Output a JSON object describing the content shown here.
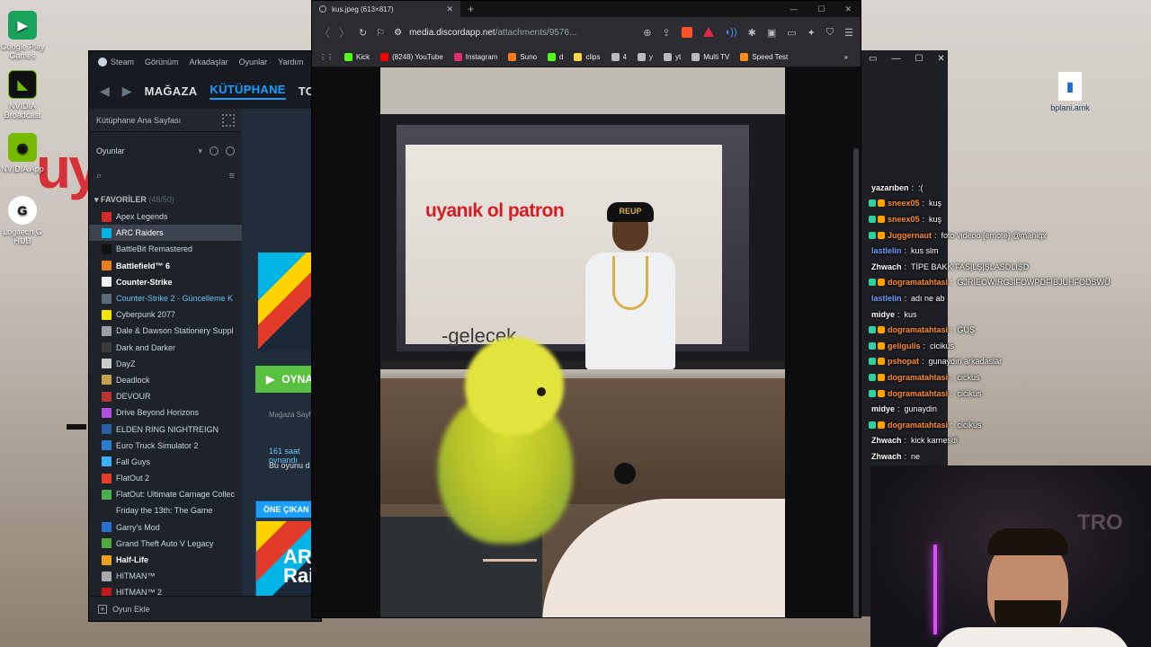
{
  "desktop": {
    "background_text": "uy",
    "icons": [
      {
        "label": "Google Play Games",
        "icon": "google-play-games-icon"
      },
      {
        "label": "NVIDIA Broadcast",
        "icon": "nvidia-broadcast-icon"
      },
      {
        "label": "NVIDIA App",
        "icon": "nvidia-app-icon"
      },
      {
        "label": "Logitech G HUB",
        "icon": "logitech-ghub-icon"
      },
      {
        "label": "bplani.amk",
        "icon": "file-icon"
      }
    ]
  },
  "steam": {
    "menu": [
      "Steam",
      "Görünüm",
      "Arkadaşlar",
      "Oyunlar",
      "Yardım"
    ],
    "nav_tabs": [
      "MAĞAZA",
      "KÜTÜPHANE",
      "TOPLULUK"
    ],
    "home_label": "Kütüphane Ana Sayfası",
    "filter_label": "Oyunlar",
    "favorites": {
      "title": "FAVORİLER",
      "count": "(48/50)"
    },
    "games": [
      {
        "name": "Apex Legends",
        "color": "#d42a2a"
      },
      {
        "name": "ARC Raiders",
        "color": "#00b4e6",
        "selected": true
      },
      {
        "name": "BattleBit Remastered",
        "color": "#111111"
      },
      {
        "name": "Battlefield™ 6",
        "color": "#e67e22",
        "bold": true
      },
      {
        "name": "Counter-Strike",
        "color": "#f0f0f0",
        "bold": true
      },
      {
        "name": "Counter-Strike 2 - Güncelleme K",
        "color": "#5a6b7a",
        "update": true
      },
      {
        "name": "Cyberpunk 2077",
        "color": "#f3e600"
      },
      {
        "name": "Dale & Dawson Stationery Suppl",
        "color": "#9aa0a6"
      },
      {
        "name": "Dark and Darker",
        "color": "#3a3a3a"
      },
      {
        "name": "DayZ",
        "color": "#cccccc"
      },
      {
        "name": "Deadlock",
        "color": "#c8a24a"
      },
      {
        "name": "DEVOUR",
        "color": "#b33"
      },
      {
        "name": "Drive Beyond Horizons",
        "color": "#b24ee0"
      },
      {
        "name": "ELDEN RING NIGHTREIGN",
        "color": "#2b5ea8"
      },
      {
        "name": "Euro Truck Simulator 2",
        "color": "#2a7dd1"
      },
      {
        "name": "Fall Guys",
        "color": "#3ab0ff"
      },
      {
        "name": "FlatOut 2",
        "color": "#e83a2a"
      },
      {
        "name": "FlatOut: Ultimate Carnage Collec",
        "color": "#4bb04b"
      },
      {
        "name": "Friday the 13th: The Game",
        "color": "#222222"
      },
      {
        "name": "Garry's Mod",
        "color": "#2a6fd1"
      },
      {
        "name": "Grand Theft Auto V Legacy",
        "color": "#4fa83f"
      },
      {
        "name": "Half-Life",
        "color": "#f0a020",
        "bold": true
      },
      {
        "name": "HITMAN™",
        "color": "#aaaaaa"
      },
      {
        "name": "HITMAN™ 2",
        "color": "#c21a1a"
      }
    ],
    "play_button": "OYNA",
    "store_page": "Mağaza Sayfası",
    "hours": "161 saat oynandı",
    "update_note": "Bu oyunu d",
    "featured_title": "ÖNE ÇIKAN",
    "featured_art_text": "ARC Raiders",
    "footer": "Oyun Ekle"
  },
  "browser": {
    "tab_title": "kus.jpeg (613×817)",
    "url_domain": "media.discordapp.net",
    "url_path": "/attachments/9576...",
    "bookmarks": [
      {
        "label": "Kick",
        "color": "#53fc18"
      },
      {
        "label": "(8248) YouTube",
        "color": "#ff0000"
      },
      {
        "label": "Instagram",
        "color": "#e1306c"
      },
      {
        "label": "Suno",
        "color": "#ff7a1a"
      },
      {
        "label": "d",
        "color": "#53fc18"
      },
      {
        "label": "clips",
        "color": "#ffd24a"
      },
      {
        "label": "4",
        "color": "#bbbbbb"
      },
      {
        "label": "y",
        "color": "#bbbbbb"
      },
      {
        "label": "yt",
        "color": "#bbbbbb"
      },
      {
        "label": "Multi TV",
        "color": "#bbbbbb"
      },
      {
        "label": "Speed Test",
        "color": "#ff8c1a"
      }
    ],
    "image": {
      "overlay_red": "uyanık ol patron",
      "overlay_gray": "-gelecek",
      "cap_text": "REUP"
    }
  },
  "chat": {
    "lines": [
      {
        "user": "yazarıben",
        "msg": ":(",
        "color": "#ffffff"
      },
      {
        "user": "sneex05",
        "msg": "kuş",
        "color": "#ff8c2b"
      },
      {
        "user": "sneex05",
        "msg": "kuş",
        "color": "#ff8c2b"
      },
      {
        "user": "Juggernaut",
        "msg": "foto videoo [emote] @maniqx",
        "color": "#ff8c2b"
      },
      {
        "user": "lastlelin",
        "msg": "kus slm",
        "color": "#6ca0ff"
      },
      {
        "user": "Zhwach",
        "msg": "TİPE BAKK FAS|LŞ|ŞLASDLIŞD",
        "color": "#ffffff"
      },
      {
        "user": "dogramatahtasi",
        "msg": "GJRIEOWIRGJIFOWPDFIBJUHFODSWÜ",
        "color": "#ff8c2b"
      },
      {
        "user": "lastlelin",
        "msg": "adı ne ab",
        "color": "#6ca0ff"
      },
      {
        "user": "midye",
        "msg": "kus",
        "color": "#ffffff"
      },
      {
        "user": "dogramatahtasi",
        "msg": "GUŞ",
        "color": "#ff8c2b"
      },
      {
        "user": "geligulis",
        "msg": "cicikus",
        "color": "#ff8c2b"
      },
      {
        "user": "pshopat",
        "msg": "gunaydın arkadaslar",
        "color": "#ff8c2b"
      },
      {
        "user": "dogramatahtasi",
        "msg": "cickus",
        "color": "#ff8c2b"
      },
      {
        "user": "dogramatahtasi",
        "msg": "cicikus",
        "color": "#ff8c2b"
      },
      {
        "user": "midye",
        "msg": "gunaydin",
        "color": "#ffffff"
      },
      {
        "user": "dogramatahtasi",
        "msg": "cicikus",
        "color": "#ff8c2b"
      },
      {
        "user": "Zhwach",
        "msg": "kick karnesdi",
        "color": "#ffffff"
      },
      {
        "user": "Zhwach",
        "msg": "ne",
        "color": "#ffffff"
      }
    ]
  },
  "webcam": {
    "sign_text": "TRO"
  }
}
